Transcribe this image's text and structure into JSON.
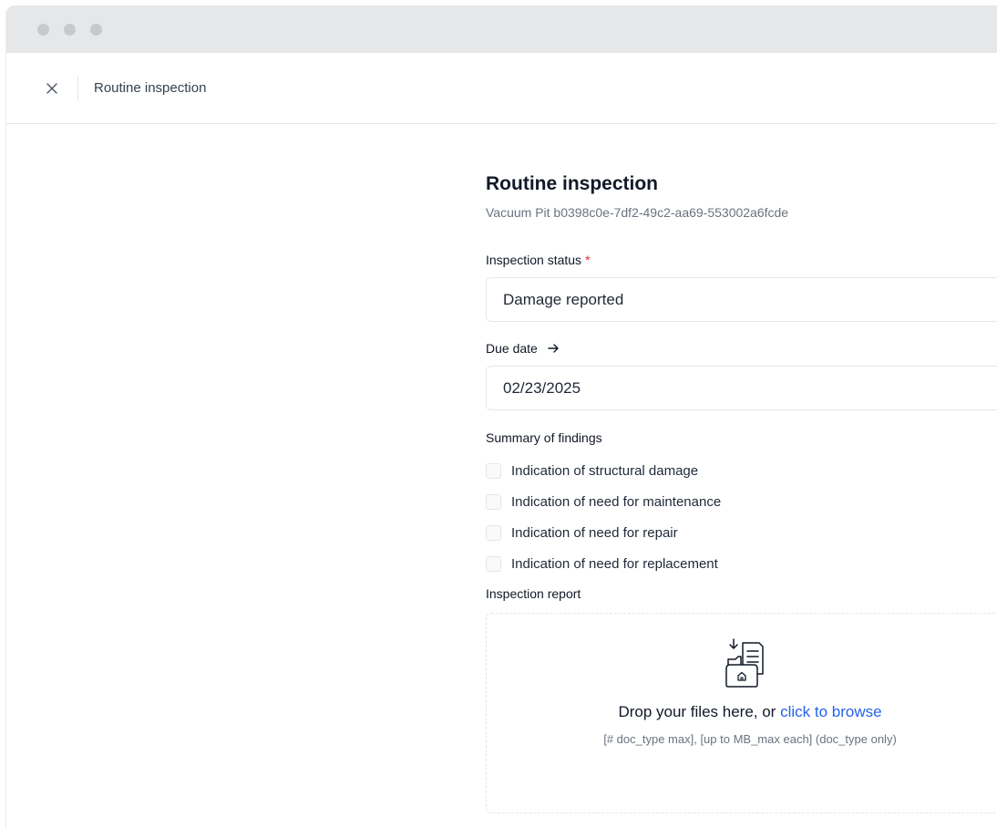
{
  "header": {
    "title": "Routine inspection",
    "close_icon": "close-icon"
  },
  "form": {
    "title": "Routine inspection",
    "subtitle": "Vacuum Pit b0398c0e-7df2-49c2-aa69-553002a6fcde",
    "inspection_status": {
      "label": "Inspection status",
      "required_mark": "*",
      "value": "Damage reported"
    },
    "due_date": {
      "label": "Due date",
      "icon": "arrow-right-icon",
      "value": "02/23/2025"
    },
    "summary": {
      "label": "Summary of findings",
      "items": [
        {
          "label": "Indication of structural damage",
          "checked": false
        },
        {
          "label": "Indication of need for maintenance",
          "checked": false
        },
        {
          "label": "Indication of need for repair",
          "checked": false
        },
        {
          "label": "Indication of need for replacement",
          "checked": false
        }
      ]
    },
    "report": {
      "label": "Inspection report",
      "icon": "folder-upload-icon",
      "drop_text": "Drop your files here, or ",
      "browse_text": "click to browse",
      "hint": "[# doc_type max], [up to MB_max each] (doc_type only)"
    }
  },
  "colors": {
    "accent": "#2563eb",
    "required": "#dc2626",
    "titlebar": "#e6e7e9",
    "border": "#e5e7eb"
  }
}
